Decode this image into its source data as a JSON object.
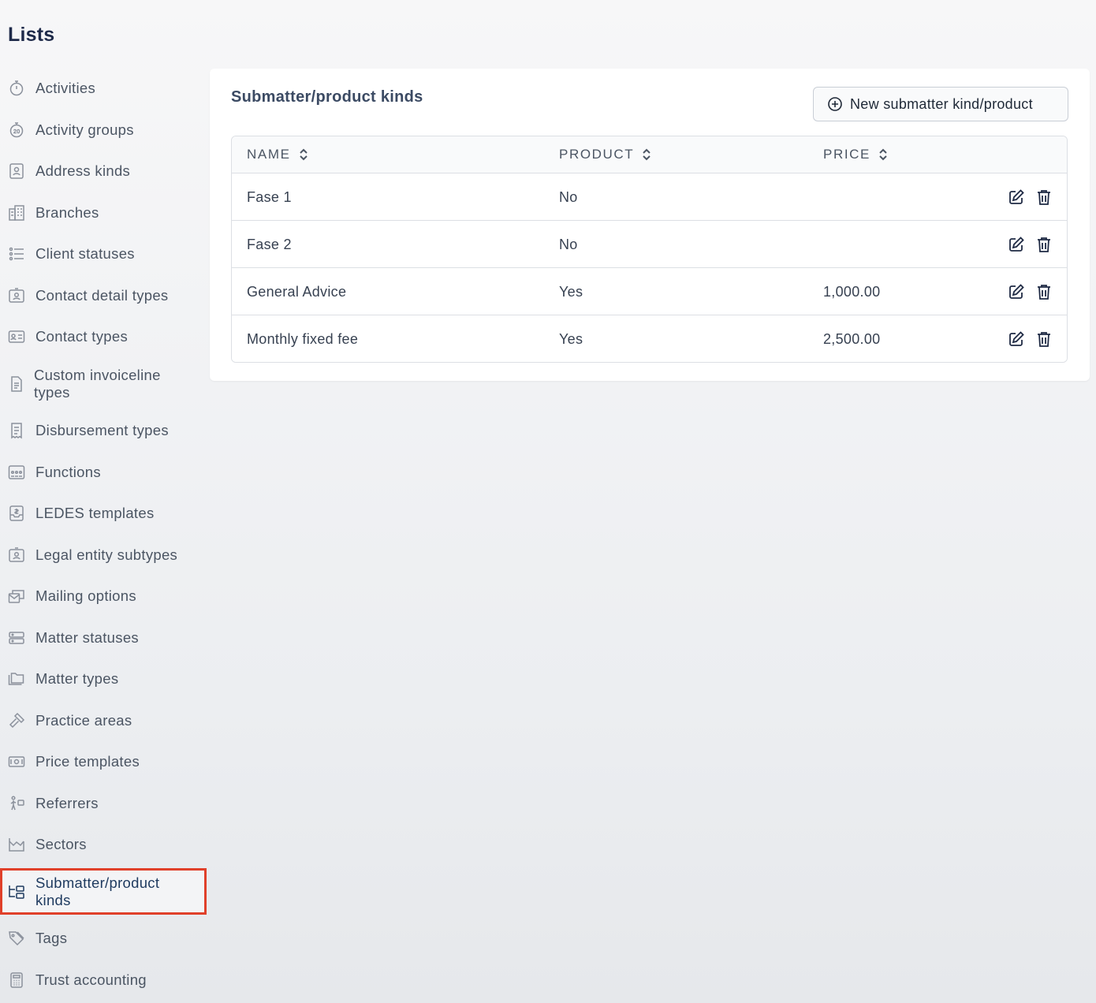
{
  "page_title": "Lists",
  "sidebar": {
    "items": [
      {
        "label": "Activities",
        "icon": "stopwatch-icon"
      },
      {
        "label": "Activity groups",
        "icon": "timer-20-icon"
      },
      {
        "label": "Address kinds",
        "icon": "contact-card-icon"
      },
      {
        "label": "Branches",
        "icon": "buildings-icon"
      },
      {
        "label": "Client statuses",
        "icon": "status-list-icon"
      },
      {
        "label": "Contact detail types",
        "icon": "id-badge-icon"
      },
      {
        "label": "Contact types",
        "icon": "id-card-icon"
      },
      {
        "label": "Custom invoiceline types",
        "icon": "document-icon"
      },
      {
        "label": "Disbursement types",
        "icon": "receipt-icon"
      },
      {
        "label": "Functions",
        "icon": "people-group-icon"
      },
      {
        "label": "LEDES templates",
        "icon": "money-inbox-icon"
      },
      {
        "label": "Legal entity subtypes",
        "icon": "id-badge-icon"
      },
      {
        "label": "Mailing options",
        "icon": "mail-options-icon"
      },
      {
        "label": "Matter statuses",
        "icon": "server-stack-icon"
      },
      {
        "label": "Matter types",
        "icon": "folders-icon"
      },
      {
        "label": "Practice areas",
        "icon": "gavel-icon"
      },
      {
        "label": "Price templates",
        "icon": "banknote-icon"
      },
      {
        "label": "Referrers",
        "icon": "referrer-icon"
      },
      {
        "label": "Sectors",
        "icon": "chart-area-icon"
      },
      {
        "label": "Submatter/product kinds",
        "icon": "hierarchy-icon",
        "active": true
      },
      {
        "label": "Tags",
        "icon": "tags-icon"
      },
      {
        "label": "Trust accounting",
        "icon": "calculator-icon"
      }
    ]
  },
  "main": {
    "title": "Submatter/product kinds",
    "new_button": "New submatter kind/product",
    "columns": [
      "NAME",
      "PRODUCT",
      "PRICE"
    ],
    "rows": [
      {
        "name": "Fase 1",
        "product": "No",
        "price": ""
      },
      {
        "name": "Fase 2",
        "product": "No",
        "price": ""
      },
      {
        "name": "General Advice",
        "product": "Yes",
        "price": "1,000.00"
      },
      {
        "name": "Monthly fixed fee",
        "product": "Yes",
        "price": "2,500.00"
      }
    ]
  },
  "colors": {
    "active_highlight": "#e0402a",
    "title": "#1e2a4a"
  }
}
